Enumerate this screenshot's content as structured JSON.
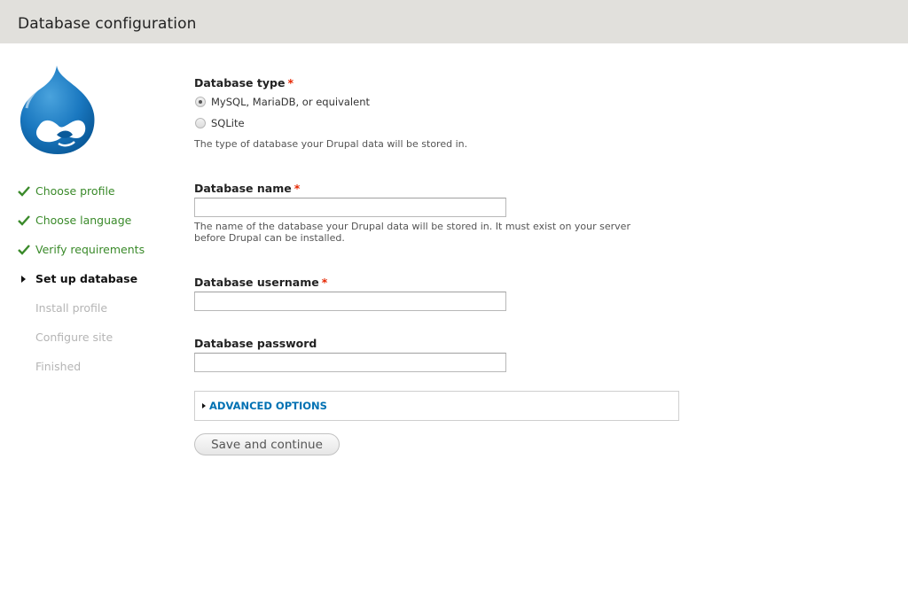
{
  "header": {
    "title": "Database configuration"
  },
  "logo": {
    "name": "Drupal",
    "color": "#0678be"
  },
  "steps": [
    {
      "label": "Choose profile",
      "state": "done"
    },
    {
      "label": "Choose language",
      "state": "done"
    },
    {
      "label": "Verify requirements",
      "state": "done"
    },
    {
      "label": "Set up database",
      "state": "active"
    },
    {
      "label": "Install profile",
      "state": "todo"
    },
    {
      "label": "Configure site",
      "state": "todo"
    },
    {
      "label": "Finished",
      "state": "todo"
    }
  ],
  "form": {
    "required_marker": "*",
    "database_type": {
      "label": "Database type",
      "options": [
        {
          "label": "MySQL, MariaDB, or equivalent",
          "checked": true
        },
        {
          "label": "SQLite",
          "checked": false
        }
      ],
      "description": "The type of database your Drupal data will be stored in."
    },
    "database_name": {
      "label": "Database name",
      "value": "",
      "description_line1": "The name of the database your Drupal data will be stored in. It must exist on your server",
      "description_line2": "before Drupal can be installed."
    },
    "database_username": {
      "label": "Database username",
      "value": ""
    },
    "database_password": {
      "label": "Database password",
      "value": ""
    },
    "advanced_options": {
      "label": "ADVANCED OPTIONS",
      "expanded": false
    },
    "submit": {
      "label": "Save and continue"
    }
  },
  "colors": {
    "done": "#3a8a2a",
    "link": "#0071b3",
    "required": "#e62600",
    "header_bg": "#e1e0dc"
  }
}
